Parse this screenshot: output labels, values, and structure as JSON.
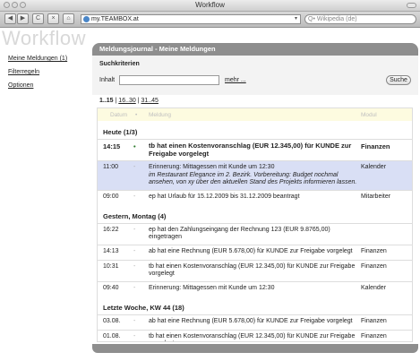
{
  "window": {
    "title": "Workflow"
  },
  "browser": {
    "url": "my.TEAMBOX.at",
    "search_placeholder": "Q• Wikipedia (de)",
    "back": "◀",
    "forward": "▶",
    "reload": "C",
    "stop": "×",
    "home": "⌂",
    "dropdown": "▾"
  },
  "app": {
    "title": "Workflow"
  },
  "sidebar": {
    "items": [
      {
        "label": "Meine Meldungen (1)"
      },
      {
        "label": "Filterregeln"
      },
      {
        "label": "Optionen"
      }
    ]
  },
  "panel": {
    "header": "Meldungsjournal - Meine Meldungen",
    "search": {
      "heading": "Suchkriterien",
      "label": "Inhalt",
      "value": "",
      "more": "mehr ...",
      "button": "Suche"
    },
    "pager": {
      "current": "1..15",
      "sep1": " | ",
      "p2": "16..30",
      "sep2": " | ",
      "p3": "31..45"
    },
    "columns": {
      "date": "Datum",
      "dot": "•",
      "message": "Meldung",
      "module": "Modul"
    },
    "groups": [
      {
        "title": "Heute (1/3)",
        "rows": [
          {
            "date": "14:15",
            "dot": "•",
            "message": "tb hat einen Kostenvoranschlag (EUR 12.345,00) für KUNDE zur Freigabe vorgelegt",
            "module": "Finanzen"
          },
          {
            "date": "11:00",
            "dot": "-",
            "message": "Erinnerung: Mittagessen mit Kunde um 12:30",
            "message2": "im Restaurant Elegance im 2. Bezirk. Vorbereitung: Budget nochmal ansehen, von xy über den aktuellen Stand des Projekts informieren lassen.",
            "module": "Kalender"
          },
          {
            "date": "09:00",
            "dot": "-",
            "message": "ep hat Urlaub für 15.12.2009 bis 31.12.2009 beantragt",
            "module": "Mitarbeiter"
          }
        ]
      },
      {
        "title": "Gestern, Montag (4)",
        "rows": [
          {
            "date": "16:22",
            "dot": "-",
            "message": "ep hat den Zahlungseingang der Rechnung 123 (EUR 9.8765,00) eingetragen",
            "module": ""
          },
          {
            "date": "14:13",
            "dot": "-",
            "message": "ab hat eine Rechnung (EUR 5.678,00) für KUNDE zur Freigabe vorgelegt",
            "module": "Finanzen"
          },
          {
            "date": "10:31",
            "dot": "-",
            "message": "tb hat einen Kostenvoranschlag (EUR 12.345,00) für KUNDE zur Freigabe vorgelegt",
            "module": "Finanzen"
          },
          {
            "date": "09:40",
            "dot": "-",
            "message": "Erinnerung: Mittagessen mit Kunde um 12:30",
            "module": "Kalender"
          }
        ]
      },
      {
        "title": "Letzte Woche, KW 44 (18)",
        "rows": [
          {
            "date": "03.08.",
            "dot": "-",
            "message": "ab hat eine Rechnung (EUR 5.678,00) für KUNDE zur Freigabe vorgelegt",
            "module": "Finanzen"
          },
          {
            "date": "01.08.",
            "dot": "-",
            "message": "tb hat einen Kostenvoranschlag (EUR 12.345,00) für KUNDE zur Freigabe vorgelegt",
            "module": "Finanzen"
          }
        ]
      }
    ]
  },
  "colors": {
    "header_bg": "#8e8e8e",
    "selected_row": "#d9dff5",
    "column_header_bg": "#fdfbe0",
    "unread_dot": "#2d7a2d"
  }
}
